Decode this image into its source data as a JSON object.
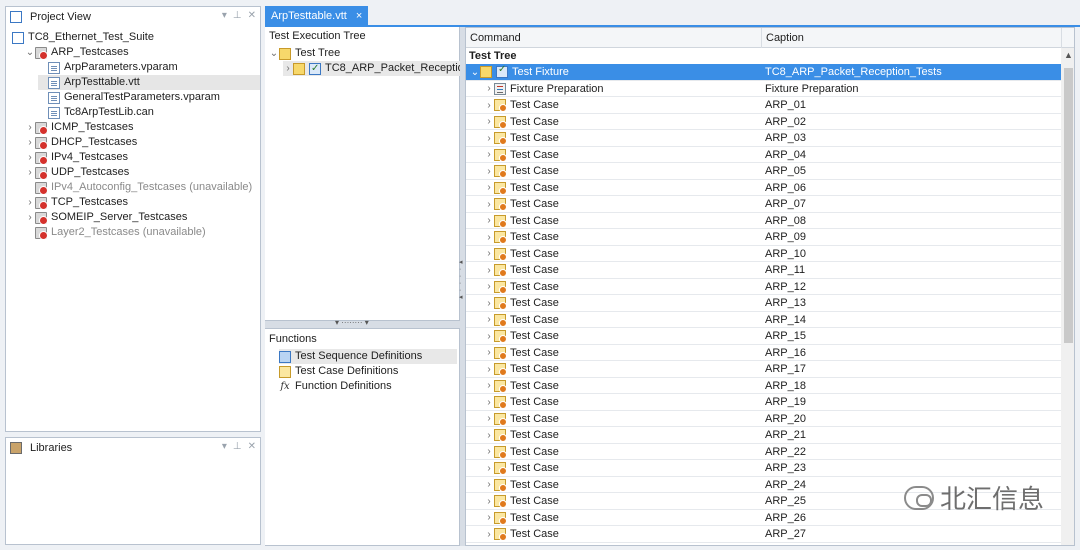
{
  "project_view": {
    "title": "Project View",
    "items": [
      {
        "label": "TC8_Ethernet_Test_Suite",
        "icon": "suite-icon",
        "expander": ""
      },
      {
        "label": "ARP_Testcases",
        "icon": "testcase-folder-icon",
        "expander": "expanded"
      },
      {
        "label": "ArpParameters.vparam",
        "icon": "vparam-file-icon",
        "expander": ""
      },
      {
        "label": "ArpTesttable.vtt",
        "icon": "vtt-file-icon",
        "expander": "",
        "selected": true
      },
      {
        "label": "GeneralTestParameters.vparam",
        "icon": "vparam-file-icon",
        "expander": ""
      },
      {
        "label": "Tc8ArpTestLib.can",
        "icon": "can-file-icon",
        "expander": ""
      },
      {
        "label": "ICMP_Testcases",
        "icon": "testcase-folder-icon",
        "expander": "collapsed"
      },
      {
        "label": "DHCP_Testcases",
        "icon": "testcase-folder-icon",
        "expander": "collapsed"
      },
      {
        "label": "IPv4_Testcases",
        "icon": "testcase-folder-icon",
        "expander": "collapsed"
      },
      {
        "label": "UDP_Testcases",
        "icon": "testcase-folder-icon",
        "expander": "collapsed"
      },
      {
        "label": "IPv4_Autoconfig_Testcases (unavailable)",
        "icon": "testcase-folder-icon",
        "expander": "",
        "unavailable": true
      },
      {
        "label": "TCP_Testcases",
        "icon": "testcase-folder-icon",
        "expander": "collapsed"
      },
      {
        "label": "SOMEIP_Server_Testcases",
        "icon": "testcase-folder-icon",
        "expander": "collapsed"
      },
      {
        "label": "Layer2_Testcases (unavailable)",
        "icon": "testcase-folder-icon",
        "expander": "",
        "unavailable": true
      }
    ]
  },
  "libraries": {
    "title": "Libraries"
  },
  "editor_tab": {
    "label": "ArpTesttable.vtt",
    "close": "×"
  },
  "test_execution_tree": {
    "title": "Test Execution Tree",
    "root": "Test Tree",
    "child": "TC8_ARP_Packet_Receptio..."
  },
  "functions": {
    "title": "Functions",
    "items": [
      "Test Sequence Definitions",
      "Test Case Definitions",
      "Function Definitions"
    ]
  },
  "grid": {
    "columns": [
      "Command",
      "Caption"
    ],
    "group_label": "Test Tree",
    "fixture": {
      "command": "Test Fixture",
      "caption": "TC8_ARP_Packet_Reception_Tests"
    },
    "preparation": {
      "command": "Fixture Preparation",
      "caption": "Fixture Preparation"
    },
    "test_case_label": "Test Case",
    "captions": [
      "ARP_01",
      "ARP_02",
      "ARP_03",
      "ARP_04",
      "ARP_05",
      "ARP_06",
      "ARP_07",
      "ARP_08",
      "ARP_09",
      "ARP_10",
      "ARP_11",
      "ARP_12",
      "ARP_13",
      "ARP_14",
      "ARP_15",
      "ARP_16",
      "ARP_17",
      "ARP_18",
      "ARP_19",
      "ARP_20",
      "ARP_21",
      "ARP_22",
      "ARP_23",
      "ARP_24",
      "ARP_25",
      "ARP_26",
      "ARP_27"
    ]
  },
  "watermark": {
    "text": "北汇信息"
  },
  "colors": {
    "selection": "#3a8ee6",
    "panel_border": "#b8c2cf",
    "background": "#eef1f5"
  }
}
